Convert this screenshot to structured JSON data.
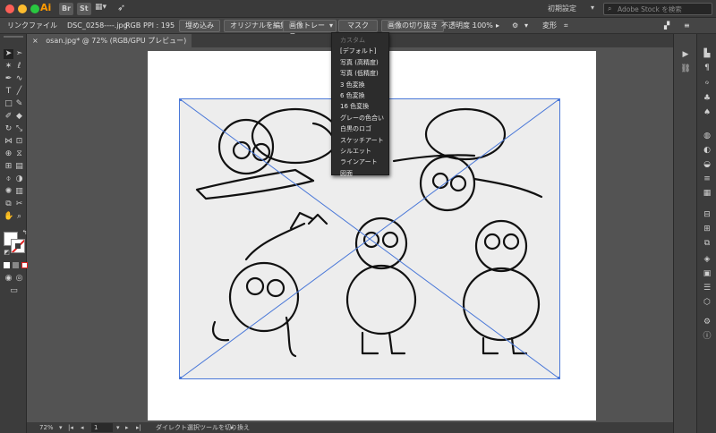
{
  "app": {
    "logo": "Ai",
    "bridge_badge": "Br",
    "stock_badge": "St",
    "workspace": "初期設定",
    "stock_search_placeholder": "Adobe Stock を検索"
  },
  "control_bar": {
    "object_type": "リンクファイル",
    "file_name": "DSC_0258----.jpg",
    "color_mode": "RGB",
    "ppi": "PPI : 195",
    "embed_button": "埋め込み",
    "edit_original_button": "オリジナルを編集",
    "image_trace_button": "画像トレース",
    "mask_button": "マスク",
    "crop_button": "画像の切り抜き",
    "opacity_label": "不透明度 :",
    "opacity_value": "100%",
    "transform_label": "変形"
  },
  "document_tab": {
    "close_glyph": "×",
    "title": "osan.jpg* @ 72% (RGB/GPU プレビュー)"
  },
  "trace_menu": {
    "items": [
      {
        "label": "カスタム",
        "enabled": false
      },
      {
        "label": "[デフォルト]",
        "enabled": true
      },
      {
        "label": "写真 (高精度)",
        "enabled": true
      },
      {
        "label": "写真 (低精度)",
        "enabled": true
      },
      {
        "label": "3 色変換",
        "enabled": true
      },
      {
        "label": "6 色変換",
        "enabled": true
      },
      {
        "label": "16 色変換",
        "enabled": true
      },
      {
        "label": "グレーの色合い",
        "enabled": true
      },
      {
        "label": "白黒のロゴ",
        "enabled": true
      },
      {
        "label": "スケッチアート",
        "enabled": true
      },
      {
        "label": "シルエット",
        "enabled": true
      },
      {
        "label": "ラインアート",
        "enabled": true
      },
      {
        "label": "図面",
        "enabled": true
      }
    ]
  },
  "status_bar": {
    "zoom": "72%",
    "artboard_number": "1",
    "status_text": "ダイレクト選択ツールを切り換え"
  },
  "colors": {
    "selection_blue": "#4a78d8",
    "fill": "#ffffff",
    "stroke_none": "#e02020"
  }
}
